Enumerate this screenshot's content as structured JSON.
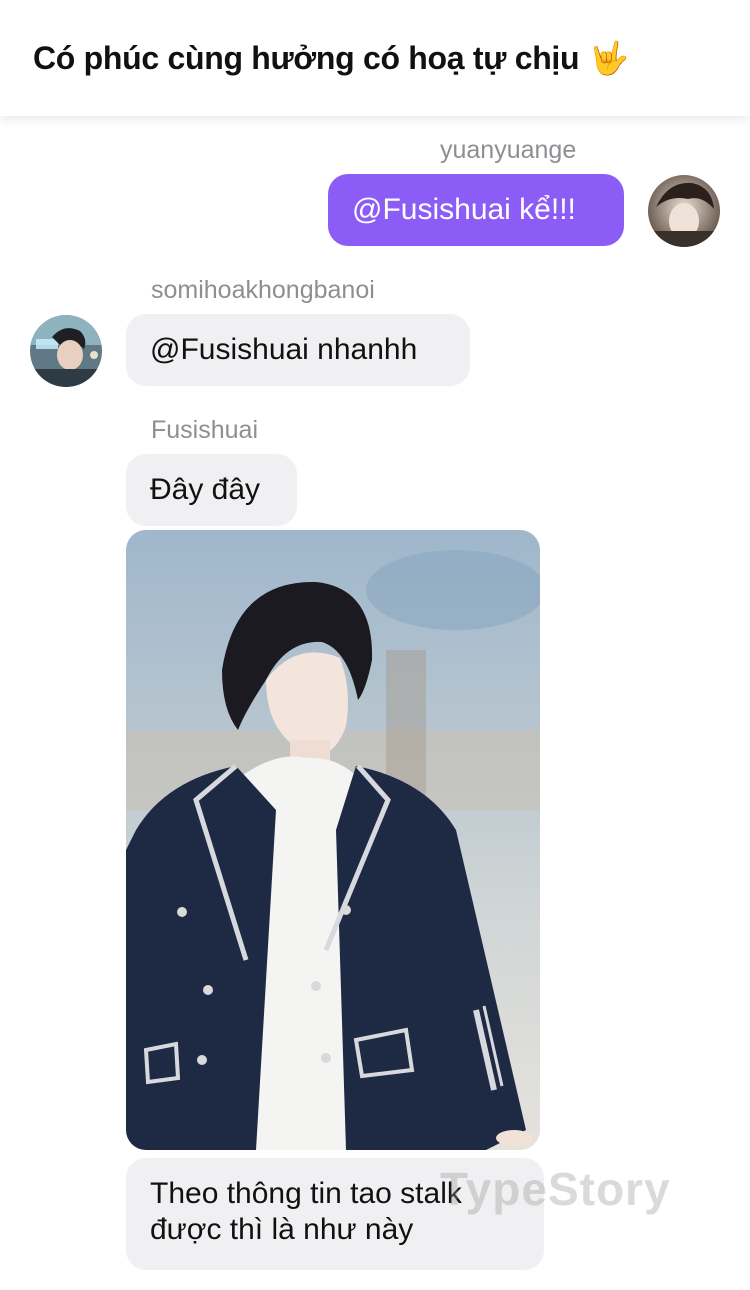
{
  "header": {
    "title": "Có phúc cùng hưởng có hoạ tự chịu",
    "emoji": "🤟"
  },
  "messages": [
    {
      "sender": "yuanyuange",
      "text": "@Fusishuai kể!!!",
      "direction": "outgoing"
    },
    {
      "sender": "somihoakhongbanoi",
      "text": "@Fusishuai nhanhh",
      "direction": "incoming"
    },
    {
      "sender": "Fusishuai",
      "text": "Đây đây",
      "direction": "incoming"
    },
    {
      "sender": "Fusishuai",
      "type": "image",
      "caption_overlay": ""
    },
    {
      "sender": "Fusishuai",
      "text_line1": "Theo thông tin tao stalk",
      "text_line2": "được thì là như này",
      "direction": "incoming"
    }
  ],
  "watermark": "TypeStory",
  "colors": {
    "outgoing_bubble": "#8b5cf6",
    "incoming_bubble": "#f0f0f2",
    "username": "#8e8e93"
  }
}
